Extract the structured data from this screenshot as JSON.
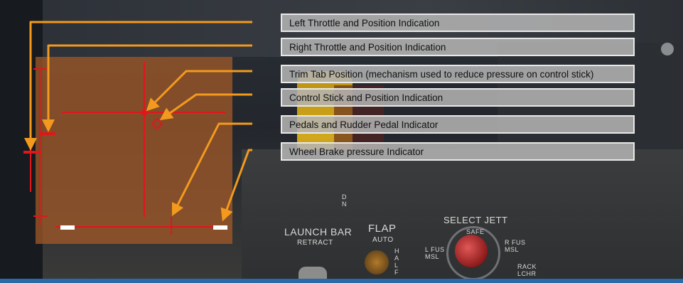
{
  "callouts": [
    {
      "label": "Left Throttle and Position Indication"
    },
    {
      "label": "Right Throttle and Position Indication"
    },
    {
      "label": "Trim Tab Position (mechanism used to reduce pressure on control stick)"
    },
    {
      "label": "Control Stick and Position Indication"
    },
    {
      "label": "Pedals and Rudder Pedal Indicator"
    },
    {
      "label": "Wheel Brake pressure Indicator"
    }
  ],
  "cockpit_panel": {
    "launch_bar": "LAUNCH BAR",
    "retract": "RETRACT",
    "flap": "FLAP",
    "auto": "AUTO",
    "half": "H A L F",
    "select_jett": "SELECT JETT",
    "safe": "SAFE",
    "l_fus_msl": "L FUS MSL",
    "r_fus_msl": "R FUS MSL",
    "rack_lchr": "RACK LCHR",
    "dn": "D N"
  },
  "colors": {
    "indicator_red": "#e0161b",
    "arrow_orange": "#f39a1e",
    "overlay": "#a85c28"
  }
}
